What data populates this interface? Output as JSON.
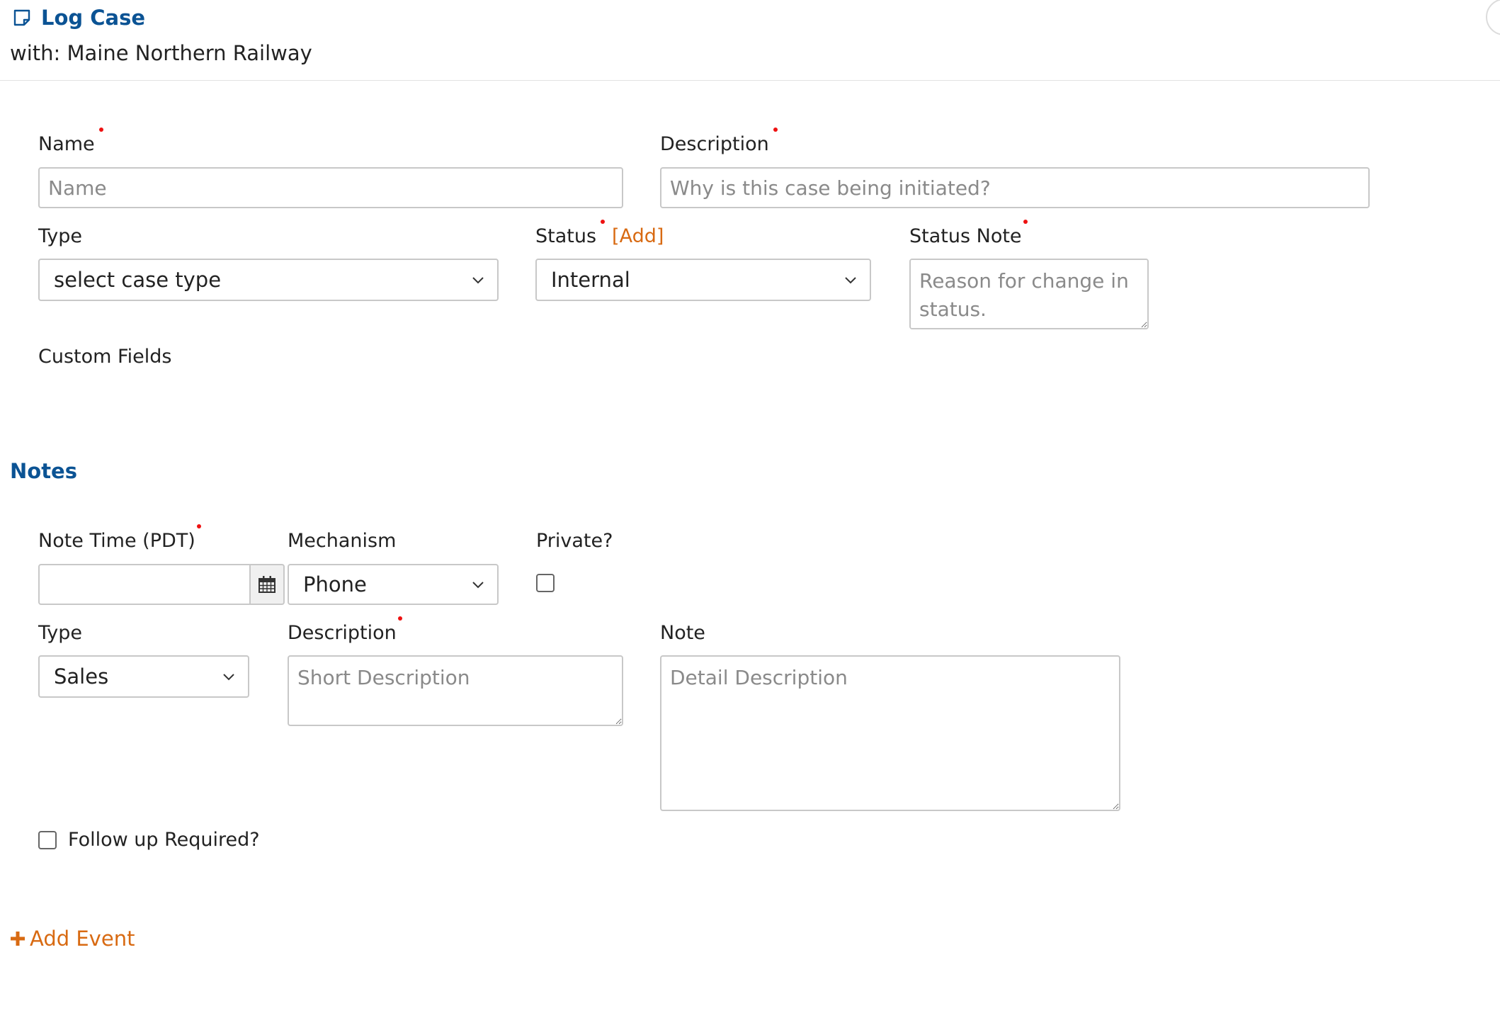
{
  "header": {
    "title": "Log Case",
    "subtitle": "with: Maine Northern Railway"
  },
  "case": {
    "name_label": "Name",
    "name_placeholder": "Name",
    "description_label": "Description",
    "description_placeholder": "Why is this case being initiated?",
    "type_label": "Type",
    "type_value": "select case type",
    "status_label": "Status",
    "status_add": "[Add]",
    "status_value": "Internal",
    "status_note_label": "Status Note",
    "status_note_placeholder": "Reason for change in status.",
    "custom_fields_label": "Custom Fields"
  },
  "notes": {
    "section_title": "Notes",
    "note_time_label": "Note Time (PDT)",
    "note_time_value": "",
    "mechanism_label": "Mechanism",
    "mechanism_value": "Phone",
    "private_label": "Private?",
    "type_label": "Type",
    "type_value": "Sales",
    "description_label": "Description",
    "description_placeholder": "Short Description",
    "note_label": "Note",
    "note_placeholder": "Detail Description",
    "follow_up_label": "Follow up Required?"
  },
  "actions": {
    "add_event": "Add Event"
  },
  "colors": {
    "accent_blue": "#0b5394",
    "link_orange": "#d86a12",
    "required_red": "#ee1111"
  }
}
